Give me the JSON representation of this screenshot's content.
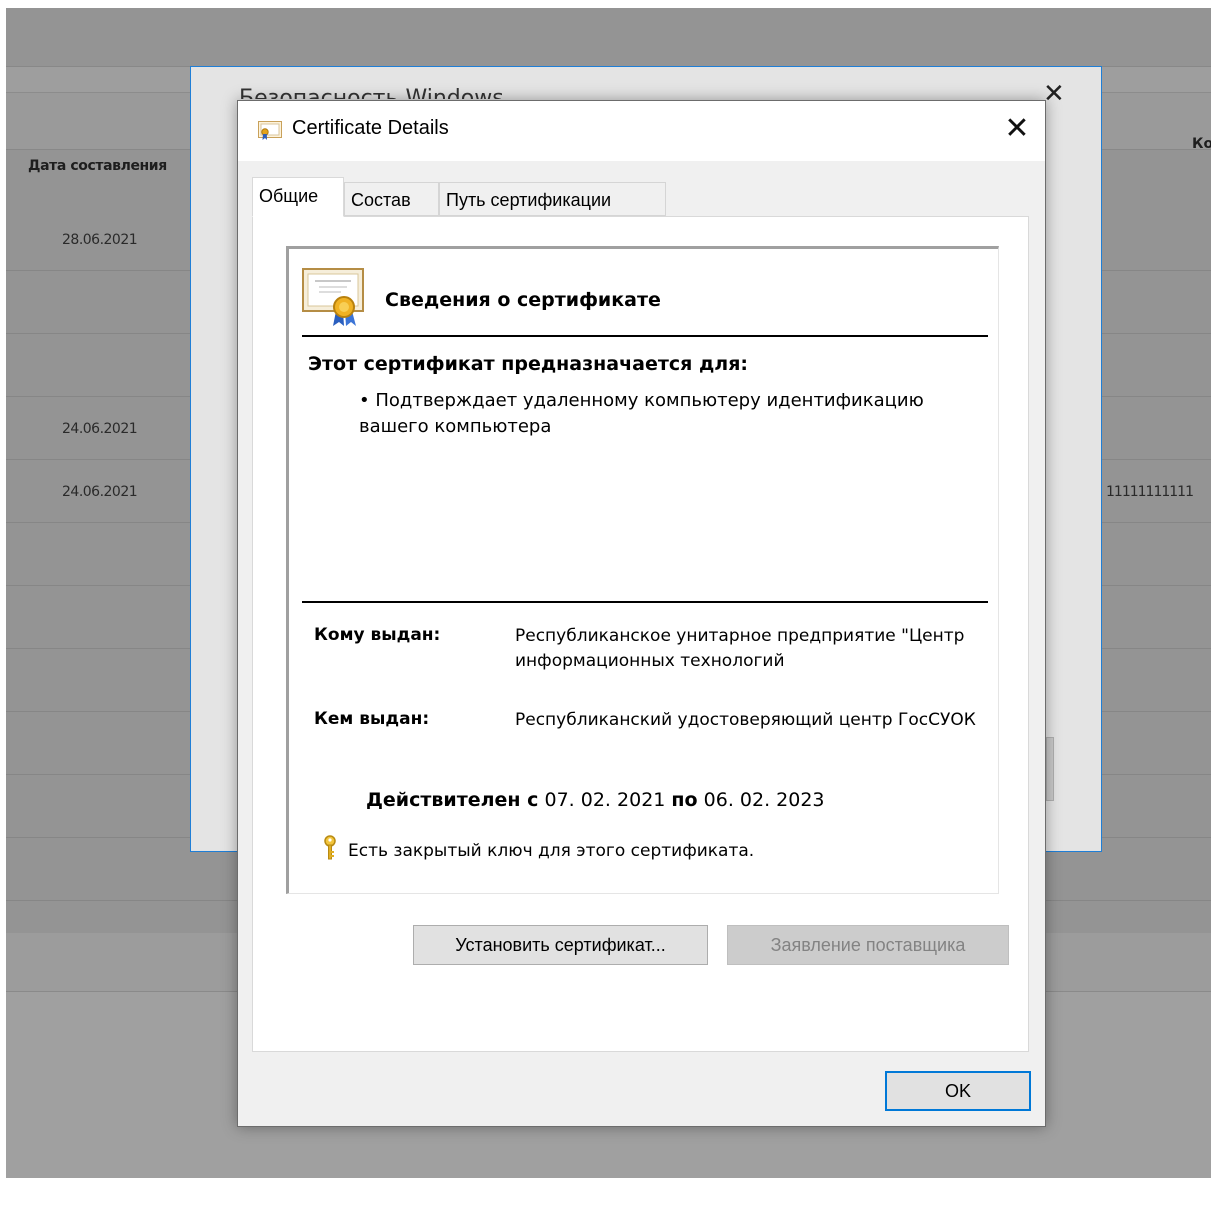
{
  "background_page": {
    "column_header_date": "Дата составления",
    "column_header_k": "Ко",
    "rows": [
      {
        "date": "28.06.2021",
        "extra": ""
      },
      {
        "date": "",
        "extra": ""
      },
      {
        "date": "",
        "extra": ""
      },
      {
        "date": "24.06.2021",
        "extra": ""
      },
      {
        "date": "24.06.2021",
        "extra": "11111111111"
      },
      {
        "date": "",
        "extra": ""
      },
      {
        "date": "",
        "extra": ""
      },
      {
        "date": "",
        "extra": ""
      },
      {
        "date": "",
        "extra": ""
      },
      {
        "date": "",
        "extra": ""
      },
      {
        "date": "",
        "extra": ""
      }
    ]
  },
  "security_dialog": {
    "title": "Безопасность Windows",
    "close_glyph": "✕"
  },
  "cert_dialog": {
    "title": "Certificate Details",
    "close_glyph": "✕",
    "tabs": [
      {
        "label": "Общие",
        "active": true
      },
      {
        "label": "Состав",
        "active": false
      },
      {
        "label": "Путь сертификации",
        "active": false
      }
    ],
    "info_title": "Сведения о сертификате",
    "purpose_heading": "Этот сертификат предназначается для:",
    "purpose_item": "• Подтверждает удаленному компьютеру идентификацию вашего компьютера",
    "issued_to_label": "Кому выдан:",
    "issued_to_value": "Республиканское унитарное предприятие \"Центр информационных технологий",
    "issued_by_label": "Кем выдан:",
    "issued_by_value": "Республиканский удостоверяющий центр ГосСУОК",
    "valid_from_label": "Действителен с",
    "valid_from": "07. 02. 2021",
    "valid_to_label": "по",
    "valid_to": "06. 02. 2023",
    "private_key_note": "Есть закрытый ключ для этого сертификата.",
    "install_button": "Установить сертификат...",
    "issuer_statement_button": "Заявление поставщика",
    "ok_button": "OK"
  },
  "colors": {
    "accent_blue": "#0078d7",
    "dim_overlay": "#9c9c9c",
    "disabled_text": "#838383"
  }
}
